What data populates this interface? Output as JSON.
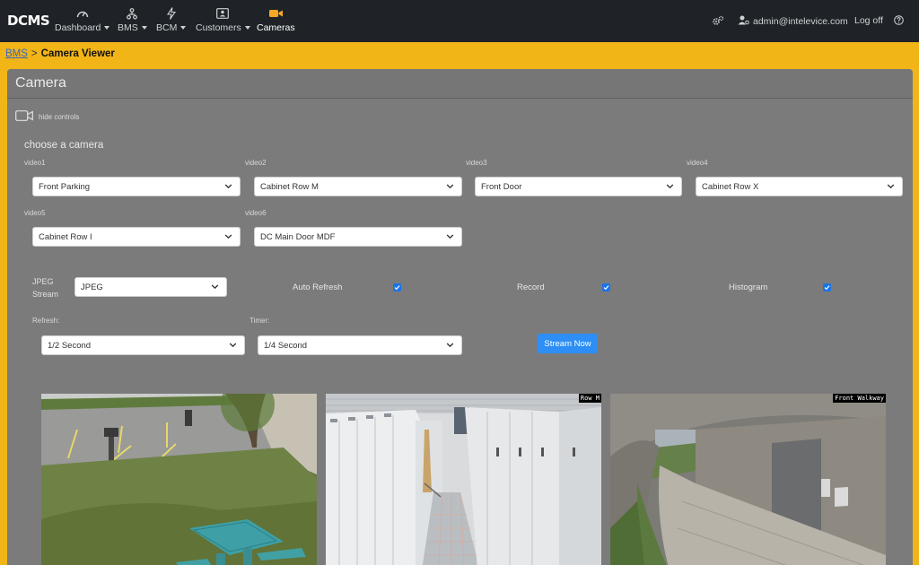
{
  "nav": {
    "logo": "DCMS",
    "items": [
      {
        "label": "Dashboard",
        "icon": "gauge-icon",
        "dropdown": true
      },
      {
        "label": "BMS",
        "icon": "sitemap-icon",
        "dropdown": true
      },
      {
        "label": "BCM",
        "icon": "bolt-icon",
        "dropdown": true
      },
      {
        "label": "Customers",
        "icon": "id-card-icon",
        "dropdown": true
      },
      {
        "label": "Cameras",
        "icon": "video-camera-icon",
        "dropdown": false,
        "active": true
      }
    ],
    "user": "admin@intelevice.com",
    "logoff": "Log off",
    "accent_color": "#f5a623"
  },
  "breadcrumb": {
    "root": "BMS",
    "separator": ">",
    "current": "Camera Viewer"
  },
  "card": {
    "title": "Camera",
    "hide_controls": "hide controls",
    "choose": "choose a camera"
  },
  "videos": [
    {
      "label": "video1",
      "value": "Front Parking"
    },
    {
      "label": "video2",
      "value": "Cabinet Row M"
    },
    {
      "label": "video3",
      "value": "Front Door"
    },
    {
      "label": "video4",
      "value": "Cabinet Row X"
    },
    {
      "label": "video5",
      "value": "Cabinet Row I"
    },
    {
      "label": "video6",
      "value": "DC Main Door MDF"
    }
  ],
  "stream": {
    "label_line1": "JPEG",
    "label_line2": "Stream",
    "value": "JPEG"
  },
  "options": [
    {
      "label": "Auto Refresh",
      "checked": true
    },
    {
      "label": "Record",
      "checked": true
    },
    {
      "label": "Histogram",
      "checked": true
    }
  ],
  "refresh": {
    "label": "Refresh:",
    "value": "1/2 Second"
  },
  "timer": {
    "label": "Timer:",
    "value": "1/4 Second"
  },
  "stream_button": "Stream Now",
  "feeds": [
    {
      "overlay": ""
    },
    {
      "overlay": "Row M"
    },
    {
      "overlay": "Front Walkway"
    }
  ],
  "colors": {
    "page_bg": "#f2b518",
    "navbar": "#1f2327",
    "card": "#7b7b7b",
    "button": "#2d8ff5",
    "checkbox": "#1a73e8"
  }
}
